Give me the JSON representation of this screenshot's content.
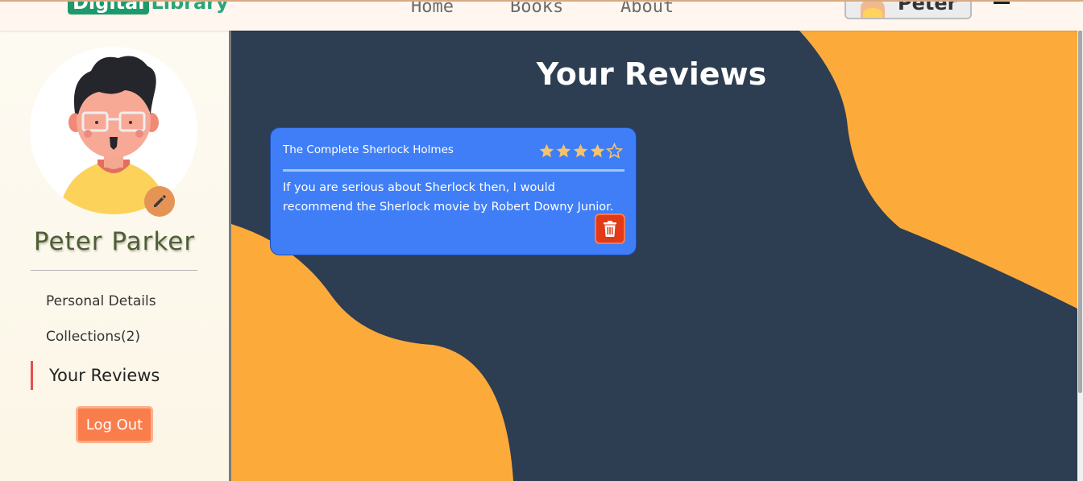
{
  "header": {
    "logo": {
      "part1": "Digital",
      "part2": "Library"
    },
    "nav": {
      "home": "Home",
      "books": "Books",
      "about": "About"
    },
    "user": {
      "name": "Peter"
    }
  },
  "sidebar": {
    "profile_name": "Peter Parker",
    "menu": {
      "personal": "Personal Details",
      "collections": "Collections(2)",
      "reviews": "Your Reviews"
    },
    "logout_label": "Log Out"
  },
  "main": {
    "title": "Your Reviews",
    "reviews": [
      {
        "book": "The Complete Sherlock Holmes",
        "rating": 4,
        "max_rating": 5,
        "text": "If you are serious about Sherlock then, I would recommend the Sherlock movie by Robert Downy Junior."
      }
    ]
  },
  "colors": {
    "main_bg": "#2d3d52",
    "blob": "#fcab3b",
    "card": "#3f7ef7",
    "delete": "#e23a16",
    "logout": "#fa7d4c",
    "star": "#f5c36a"
  },
  "icons": {
    "edit": "pencil-icon",
    "delete": "trash-icon",
    "rating": "star-icon",
    "menu": "hamburger-icon"
  }
}
